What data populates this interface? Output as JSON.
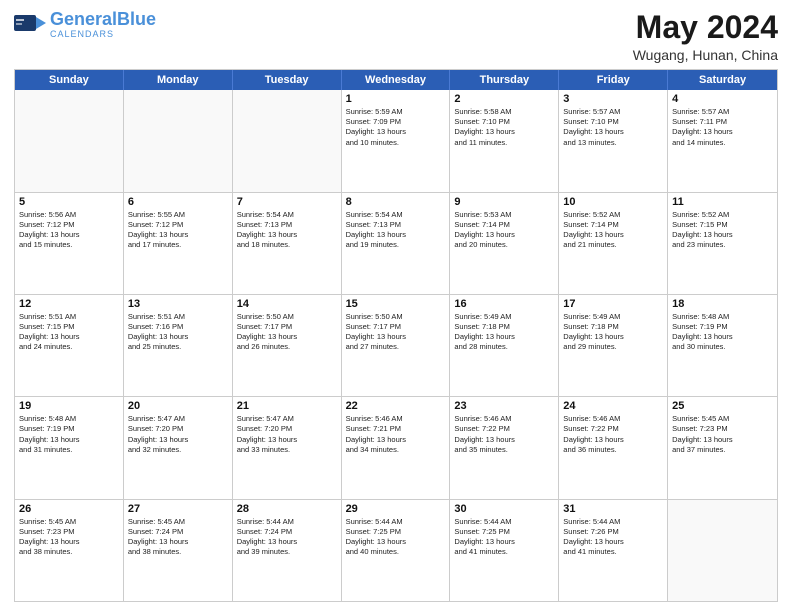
{
  "logo": {
    "general": "General",
    "blue": "Blue",
    "icon": "▶"
  },
  "title": "May 2024",
  "location": "Wugang, Hunan, China",
  "weekdays": [
    "Sunday",
    "Monday",
    "Tuesday",
    "Wednesday",
    "Thursday",
    "Friday",
    "Saturday"
  ],
  "weeks": [
    [
      {
        "day": "",
        "info": ""
      },
      {
        "day": "",
        "info": ""
      },
      {
        "day": "",
        "info": ""
      },
      {
        "day": "1",
        "info": "Sunrise: 5:59 AM\nSunset: 7:09 PM\nDaylight: 13 hours\nand 10 minutes."
      },
      {
        "day": "2",
        "info": "Sunrise: 5:58 AM\nSunset: 7:10 PM\nDaylight: 13 hours\nand 11 minutes."
      },
      {
        "day": "3",
        "info": "Sunrise: 5:57 AM\nSunset: 7:10 PM\nDaylight: 13 hours\nand 13 minutes."
      },
      {
        "day": "4",
        "info": "Sunrise: 5:57 AM\nSunset: 7:11 PM\nDaylight: 13 hours\nand 14 minutes."
      }
    ],
    [
      {
        "day": "5",
        "info": "Sunrise: 5:56 AM\nSunset: 7:12 PM\nDaylight: 13 hours\nand 15 minutes."
      },
      {
        "day": "6",
        "info": "Sunrise: 5:55 AM\nSunset: 7:12 PM\nDaylight: 13 hours\nand 17 minutes."
      },
      {
        "day": "7",
        "info": "Sunrise: 5:54 AM\nSunset: 7:13 PM\nDaylight: 13 hours\nand 18 minutes."
      },
      {
        "day": "8",
        "info": "Sunrise: 5:54 AM\nSunset: 7:13 PM\nDaylight: 13 hours\nand 19 minutes."
      },
      {
        "day": "9",
        "info": "Sunrise: 5:53 AM\nSunset: 7:14 PM\nDaylight: 13 hours\nand 20 minutes."
      },
      {
        "day": "10",
        "info": "Sunrise: 5:52 AM\nSunset: 7:14 PM\nDaylight: 13 hours\nand 21 minutes."
      },
      {
        "day": "11",
        "info": "Sunrise: 5:52 AM\nSunset: 7:15 PM\nDaylight: 13 hours\nand 23 minutes."
      }
    ],
    [
      {
        "day": "12",
        "info": "Sunrise: 5:51 AM\nSunset: 7:15 PM\nDaylight: 13 hours\nand 24 minutes."
      },
      {
        "day": "13",
        "info": "Sunrise: 5:51 AM\nSunset: 7:16 PM\nDaylight: 13 hours\nand 25 minutes."
      },
      {
        "day": "14",
        "info": "Sunrise: 5:50 AM\nSunset: 7:17 PM\nDaylight: 13 hours\nand 26 minutes."
      },
      {
        "day": "15",
        "info": "Sunrise: 5:50 AM\nSunset: 7:17 PM\nDaylight: 13 hours\nand 27 minutes."
      },
      {
        "day": "16",
        "info": "Sunrise: 5:49 AM\nSunset: 7:18 PM\nDaylight: 13 hours\nand 28 minutes."
      },
      {
        "day": "17",
        "info": "Sunrise: 5:49 AM\nSunset: 7:18 PM\nDaylight: 13 hours\nand 29 minutes."
      },
      {
        "day": "18",
        "info": "Sunrise: 5:48 AM\nSunset: 7:19 PM\nDaylight: 13 hours\nand 30 minutes."
      }
    ],
    [
      {
        "day": "19",
        "info": "Sunrise: 5:48 AM\nSunset: 7:19 PM\nDaylight: 13 hours\nand 31 minutes."
      },
      {
        "day": "20",
        "info": "Sunrise: 5:47 AM\nSunset: 7:20 PM\nDaylight: 13 hours\nand 32 minutes."
      },
      {
        "day": "21",
        "info": "Sunrise: 5:47 AM\nSunset: 7:20 PM\nDaylight: 13 hours\nand 33 minutes."
      },
      {
        "day": "22",
        "info": "Sunrise: 5:46 AM\nSunset: 7:21 PM\nDaylight: 13 hours\nand 34 minutes."
      },
      {
        "day": "23",
        "info": "Sunrise: 5:46 AM\nSunset: 7:22 PM\nDaylight: 13 hours\nand 35 minutes."
      },
      {
        "day": "24",
        "info": "Sunrise: 5:46 AM\nSunset: 7:22 PM\nDaylight: 13 hours\nand 36 minutes."
      },
      {
        "day": "25",
        "info": "Sunrise: 5:45 AM\nSunset: 7:23 PM\nDaylight: 13 hours\nand 37 minutes."
      }
    ],
    [
      {
        "day": "26",
        "info": "Sunrise: 5:45 AM\nSunset: 7:23 PM\nDaylight: 13 hours\nand 38 minutes."
      },
      {
        "day": "27",
        "info": "Sunrise: 5:45 AM\nSunset: 7:24 PM\nDaylight: 13 hours\nand 38 minutes."
      },
      {
        "day": "28",
        "info": "Sunrise: 5:44 AM\nSunset: 7:24 PM\nDaylight: 13 hours\nand 39 minutes."
      },
      {
        "day": "29",
        "info": "Sunrise: 5:44 AM\nSunset: 7:25 PM\nDaylight: 13 hours\nand 40 minutes."
      },
      {
        "day": "30",
        "info": "Sunrise: 5:44 AM\nSunset: 7:25 PM\nDaylight: 13 hours\nand 41 minutes."
      },
      {
        "day": "31",
        "info": "Sunrise: 5:44 AM\nSunset: 7:26 PM\nDaylight: 13 hours\nand 41 minutes."
      },
      {
        "day": "",
        "info": ""
      }
    ]
  ]
}
